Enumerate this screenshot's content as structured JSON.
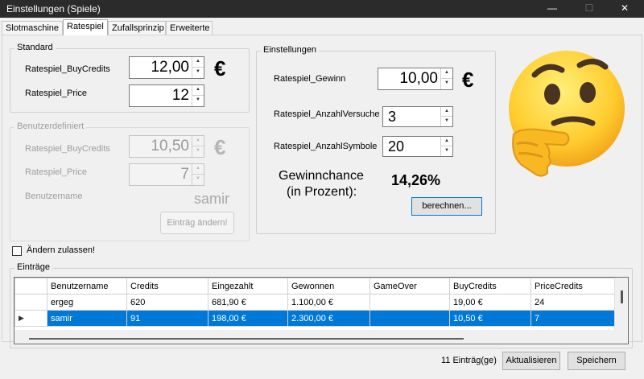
{
  "window": {
    "title": "Einstellungen (Spiele)",
    "controls": {
      "minimize": "—",
      "maximize": "☐",
      "close": "✕"
    }
  },
  "tabs": [
    "Slotmaschine",
    "Ratespiel",
    "Zufallsprinzip",
    "Erweiterte"
  ],
  "standard": {
    "title": "Standard",
    "buycredits_label": "Ratespiel_BuyCredits",
    "buycredits_value": "12,00",
    "price_label": "Ratespiel_Price",
    "price_value": "12",
    "currency": "€"
  },
  "benutzer": {
    "title": "Benutzerdefiniert",
    "buycredits_label": "Ratespiel_BuyCredits",
    "buycredits_value": "10,50",
    "price_label": "Ratespiel_Price",
    "price_value": "7",
    "username_label": "Benutzername",
    "username_value": "samir",
    "currency": "€",
    "edit_button": "Einträg ändern!"
  },
  "einstellungen": {
    "title": "Einstellungen",
    "gewinn_label": "Ratespiel_Gewinn",
    "gewinn_value": "10,00",
    "currency": "€",
    "versuche_label": "Ratespiel_AnzahlVersuche",
    "versuche_value": "3",
    "symbole_label": "Ratespiel_AnzahlSymbole",
    "symbole_value": "20",
    "chance_label_1": "Gewinnchance",
    "chance_label_2": "(in Prozent):",
    "chance_value": "14,26%",
    "calc_button": "berechnen..."
  },
  "allow_change": {
    "label": "Ändern zulassen!",
    "checked": false
  },
  "entries": {
    "title": "Einträge",
    "columns": [
      "Benutzername",
      "Credits",
      "Eingezahlt",
      "Gewonnen",
      "GameOver",
      "BuyCredits",
      "PriceCredits"
    ],
    "rows": [
      [
        "ergeg",
        "620",
        "681,90 €",
        "1.100,00 €",
        "",
        "19,00 €",
        "24"
      ],
      [
        "samir",
        "91",
        "198,00 €",
        "2.300,00 €",
        "",
        "10,50 €",
        "7"
      ]
    ],
    "selected_row": 1,
    "row_marker": "▶"
  },
  "footer": {
    "count": "11 Einträg(ge)",
    "refresh_button": "Aktualisieren",
    "save_button": "Speichern"
  },
  "emoji": {
    "icon": "thinking-face-emoji"
  }
}
